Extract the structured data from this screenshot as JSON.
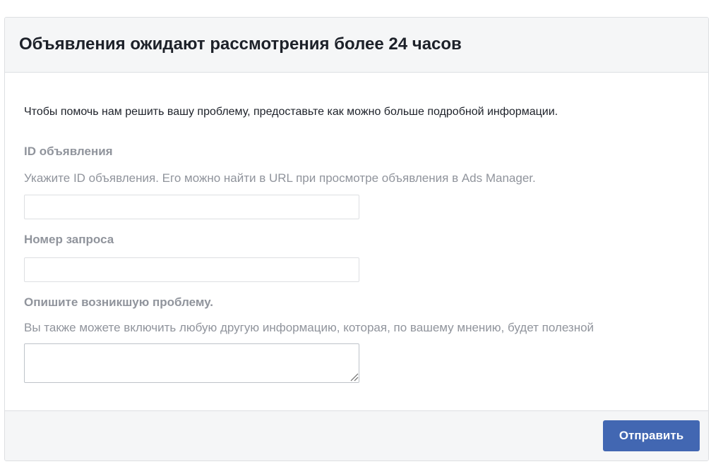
{
  "dialog": {
    "title": "Объявления ожидают рассмотрения более 24 часов",
    "intro": "Чтобы помочь нам решить вашу проблему, предоставьте как можно больше подробной информации."
  },
  "fields": {
    "ad_id": {
      "label": "ID объявления",
      "help": "Укажите ID объявления. Его можно найти в URL при просмотре объявления в Ads Manager.",
      "value": "",
      "placeholder": ""
    },
    "request_number": {
      "label": "Номер запроса",
      "value": "",
      "placeholder": ""
    },
    "problem": {
      "label": "Опишите возникшую проблему.",
      "help": "Вы также можете включить любую другую информацию, которая, по вашему мнению, будет полезной",
      "value": "",
      "placeholder": ""
    }
  },
  "footer": {
    "submit_label": "Отправить"
  },
  "colors": {
    "header_bg": "#f5f6f7",
    "border": "#dddfe2",
    "muted_text": "#90949c",
    "primary_button": "#4267b2"
  },
  "icons": {
    "textarea_resize": "resize-grip-icon"
  }
}
